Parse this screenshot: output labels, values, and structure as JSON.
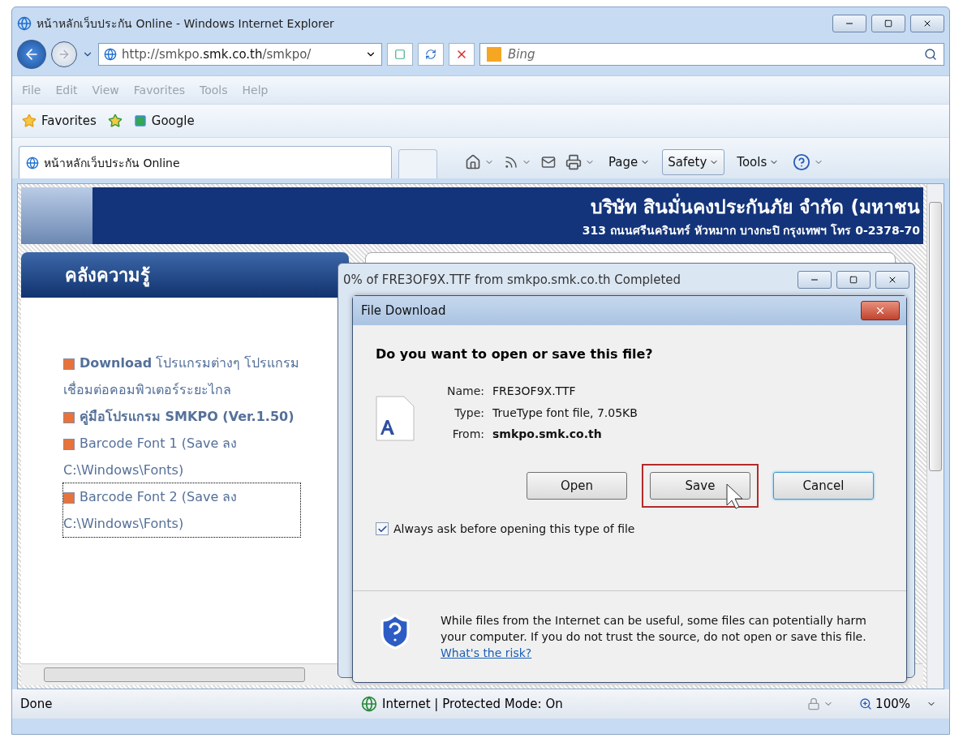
{
  "window": {
    "title": "หน้าหลักเว็บประกัน Online - Windows Internet Explorer"
  },
  "address_bar": {
    "url_prefix": "http://smkpo.",
    "url_domain": "smk.co.th",
    "url_suffix": "/smkpo/"
  },
  "search": {
    "placeholder": "Bing"
  },
  "menu_bar": [
    "File",
    "Edit",
    "View",
    "Favorites",
    "Tools",
    "Help"
  ],
  "favorites_bar": {
    "favorites": "Favorites",
    "links": [
      "Google"
    ]
  },
  "tabs": [
    {
      "label": "หน้าหลักเว็บประกัน Online",
      "selected": true
    }
  ],
  "command_bar": [
    {
      "label": "Page",
      "pressed": false
    },
    {
      "label": "Safety",
      "pressed": true
    },
    {
      "label": "Tools",
      "pressed": false
    }
  ],
  "page": {
    "company": "บริษัท สินมั่นคงประกันภัย จำกัด (มหาชน",
    "address": "313 ถนนศรีนครินทร์ หัวหมาก บางกะปิ กรุงเทพฯ โทร 0-2378-70",
    "panel_title": "คลังความรู้",
    "links": [
      {
        "text": "**Download** โปรแกรมต่างๆ โปรแกรมเชื่อมต่อคอมพิวเตอร์ระยะไกล",
        "bold": false,
        "focused": false
      },
      {
        "text": "คู่มือโปรแกรม SMKPO (Ver.1.50)",
        "bold": true,
        "focused": false
      },
      {
        "text": "Barcode Font 1 (Save ลง C:\\Windows\\Fonts)",
        "bold": false,
        "focused": false
      },
      {
        "text": "Barcode Font 2 (Save ลง C:\\Windows\\Fonts)",
        "bold": false,
        "focused": true
      }
    ]
  },
  "progress_window": {
    "title": "0% of FRE3OF9X.TTF from smkpo.smk.co.th Completed"
  },
  "dialog": {
    "title": "File Download",
    "question": "Do you want to open or save this file?",
    "fields": [
      {
        "label": "Name:",
        "value": "FRE3OF9X.TTF",
        "bold": false
      },
      {
        "label": "Type:",
        "value": "TrueType font file, 7.05KB",
        "bold": false
      },
      {
        "label": "From:",
        "value": "smkpo.smk.co.th",
        "bold": true
      }
    ],
    "buttons": [
      {
        "label": "Open",
        "highlighted": false,
        "focused": false
      },
      {
        "label": "Save",
        "highlighted": true,
        "focused": false
      },
      {
        "label": "Cancel",
        "highlighted": false,
        "focused": true
      }
    ],
    "checkbox": {
      "label": "Always ask before opening this type of file",
      "checked": true
    },
    "warning": "While files from the Internet can be useful, some files can potentially harm your computer. If you do not trust the source, do not open or save this file.",
    "risk_link": "What's the risk?"
  },
  "status_bar": {
    "status": "Done",
    "zone": "Internet | Protected Mode: On",
    "zoom": "100%"
  }
}
